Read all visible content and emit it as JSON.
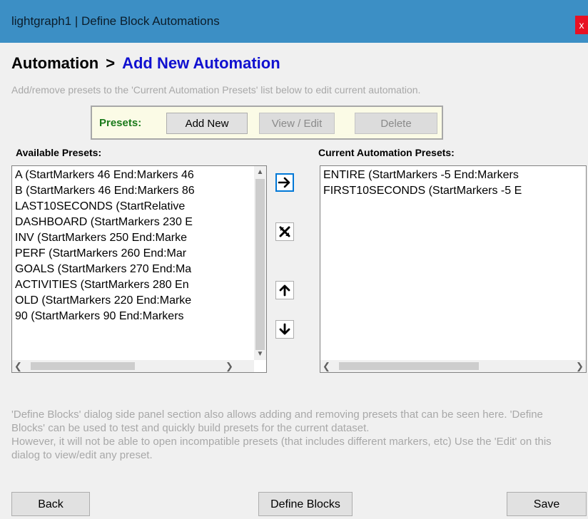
{
  "window": {
    "title": "lightgraph1 | Define Block Automations",
    "close_label": "x"
  },
  "heading": {
    "main": "Automation",
    "separator": ">",
    "sub": "Add New Automation"
  },
  "hint": "Add/remove presets to the 'Current Automation Presets' list below to edit current automation.",
  "presets_bar": {
    "label": "Presets:",
    "add_new": "Add New",
    "view_edit": "View / Edit",
    "delete": "Delete"
  },
  "available": {
    "label": "Available Presets:",
    "items": [
      "A (StartMarkers 46 End:Markers 46",
      "B (StartMarkers 46 End:Markers 86",
      "LAST10SECONDS (StartRelative",
      "DASHBOARD (StartMarkers 230 E",
      "INV (StartMarkers 250 End:Marke",
      "PERF (StartMarkers 260 End:Mar",
      "GOALS (StartMarkers 270 End:Ma",
      "ACTIVITIES (StartMarkers 280 En",
      "OLD (StartMarkers 220 End:Marke",
      "90 (StartMarkers 90 End:Markers"
    ]
  },
  "current": {
    "label": "Current Automation Presets:",
    "items": [
      "ENTIRE (StartMarkers -5 End:Markers",
      "FIRST10SECONDS (StartMarkers -5 E"
    ]
  },
  "icons": {
    "add": "arrow-right-icon",
    "remove": "cross-arrows-icon",
    "up": "arrow-up-icon",
    "down": "arrow-down-icon"
  },
  "notes": {
    "p1": "'Define Blocks' dialog side panel section also allows adding and removing presets that can be seen here.  'Define Blocks' can be used to test and quickly build presets for the current dataset.",
    "p2": "However, it will not be able to open incompatible presets (that includes different markers, etc) Use the 'Edit' on this dialog to view/edit any preset."
  },
  "buttons": {
    "back": "Back",
    "define_blocks": "Define Blocks",
    "save": "Save"
  },
  "colors": {
    "titlebar": "#3c8fc5",
    "heading_sub": "#1010d0",
    "presets_label": "#1a7a1a",
    "presets_bg": "#fbfbe6"
  }
}
